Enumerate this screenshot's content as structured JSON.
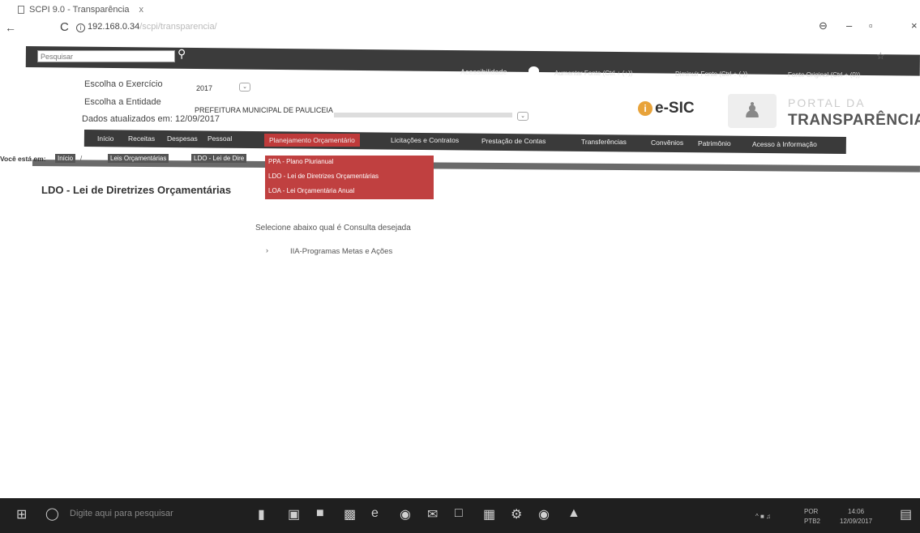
{
  "browser": {
    "tab_title": "SCPI 9.0 - Transparência",
    "tab_close": "x",
    "url": "192.168.0.34",
    "url_faded": "/scpi/transparencia/",
    "back": "←",
    "reload": "C",
    "window_controls": [
      "⊖",
      "–",
      "▫",
      "×"
    ]
  },
  "topbar": {
    "search_placeholder": "Pesquisar",
    "accessibility": "Acessibilidade",
    "increase_font": "Aumentar Fonte (Ctrl + (+))",
    "decrease_font": "Diminuir Fonte (Ctrl + (-))",
    "original_font": "Fonte Original (Ctrl + (0))"
  },
  "filters": {
    "exercise_label": "Escolha o Exercício",
    "exercise_value": "2017",
    "entity_label": "Escolha a Entidade",
    "entity_value": "PREFEITURA MUNICIPAL DE PAULICEIA",
    "updated_label": "Dados atualizados em: 12/09/2017"
  },
  "logos": {
    "esic": "e-SIC",
    "portal_top": "PORTAL DA",
    "portal_main": "TRANSPARÊNCIA"
  },
  "nav": {
    "items": [
      "Início",
      "Receitas",
      "Despesas",
      "Pessoal",
      "Planejamento Orçamentário",
      "Licitações e Contratos",
      "Prestação de Contas",
      "Transferências",
      "Convênios",
      "Patrimônio",
      "Acesso à Informação"
    ]
  },
  "submenu": {
    "items": [
      "PPA - Plano Plurianual",
      "LDO - Lei de Diretrizes Orçamentárias",
      "LOA - Lei Orçamentária Anual"
    ]
  },
  "breadcrumb": {
    "label": "Você está em:",
    "items": [
      "Início",
      "Leis Orçamentárias",
      "LDO - Lei de Dire"
    ]
  },
  "content": {
    "title": "LDO - Lei de Diretrizes Orçamentárias",
    "instruction": "Selecione abaixo qual é Consulta desejada",
    "option": "IIA-Programas Metas e Ações",
    "option_marker": "›"
  },
  "taskbar": {
    "search_placeholder": "Digite aqui para pesquisar",
    "lang": "POR",
    "lang2": "PTB2",
    "time": "14:06",
    "date": "12/09/2017"
  }
}
